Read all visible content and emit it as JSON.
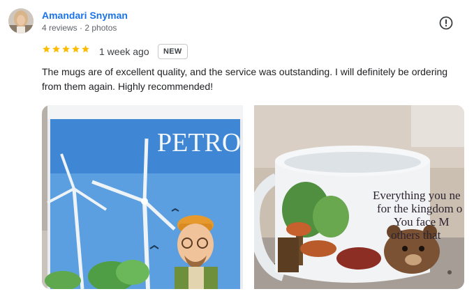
{
  "reviewer": {
    "name": "Amandari Snyman",
    "meta": "4 reviews · 2 photos"
  },
  "review": {
    "rating": 5,
    "rating_max": 5,
    "time": "1 week ago",
    "badge": "NEW",
    "text": "The mugs are of excellent quality, and the service was outstanding. I will definitely be ordering from them again. Highly recommended!"
  },
  "photos": [
    {
      "mug_text": "PETRO"
    },
    {
      "mug_text": [
        "Everything you ne",
        "for the kingdom o",
        "You face M",
        "others that"
      ]
    }
  ],
  "icons": {
    "report": "exclamation-circle-icon",
    "star": "star-icon"
  },
  "colors": {
    "name": "#1a73e8",
    "star": "#fbbc04"
  }
}
